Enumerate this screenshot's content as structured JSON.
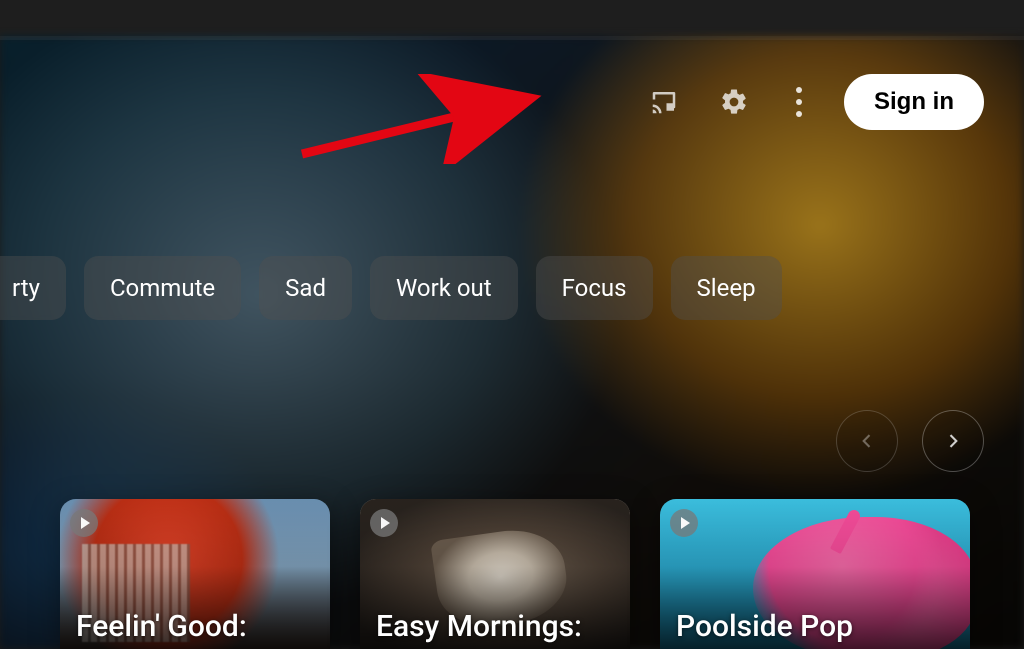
{
  "header": {
    "sign_in_label": "Sign in"
  },
  "chips": {
    "partial": "rty",
    "items": [
      "Commute",
      "Sad",
      "Work out",
      "Focus",
      "Sleep"
    ]
  },
  "cards": [
    {
      "title": "Feelin' Good:"
    },
    {
      "title": "Easy Mornings:"
    },
    {
      "title": "Poolside Pop"
    }
  ]
}
